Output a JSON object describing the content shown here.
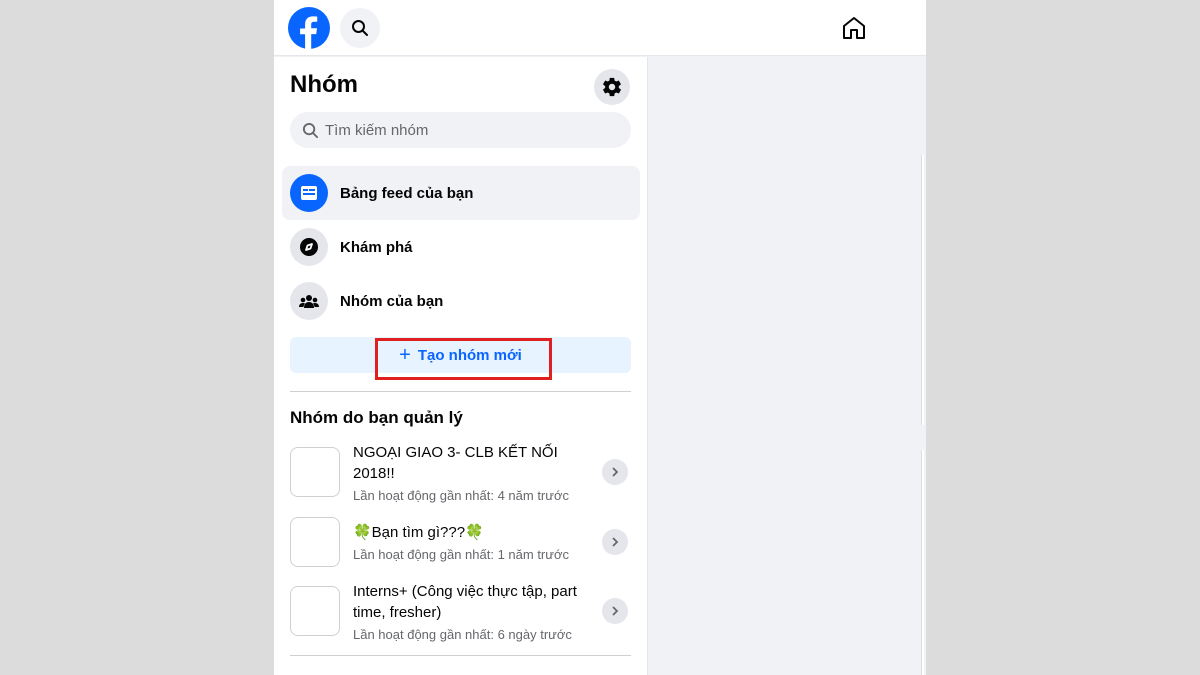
{
  "sidebar": {
    "title": "Nhóm",
    "search": {
      "placeholder": "Tìm kiếm nhóm"
    },
    "nav": [
      {
        "label": "Bảng feed của bạn",
        "icon": "feed-icon"
      },
      {
        "label": "Khám phá",
        "icon": "compass-icon"
      },
      {
        "label": "Nhóm của bạn",
        "icon": "groups-icon"
      }
    ],
    "create_label": "Tạo nhóm mới",
    "managed_title": "Nhóm do bạn quản lý",
    "groups": [
      {
        "name": "NGOẠI GIAO 3- CLB KẾT NỐI 2018!!",
        "meta": "Lần hoạt động gần nhất: 4 năm trước"
      },
      {
        "name": "🍀Bạn tìm gì???🍀",
        "meta": "Lần hoạt động gần nhất: 1 năm trước"
      },
      {
        "name": "Interns+ (Công việc thực tập, part time, fresher)",
        "meta": "Lần hoạt động gần nhất: 6 ngày trước"
      }
    ]
  },
  "colors": {
    "brand": "#0866ff",
    "highlight": "#e02020"
  }
}
